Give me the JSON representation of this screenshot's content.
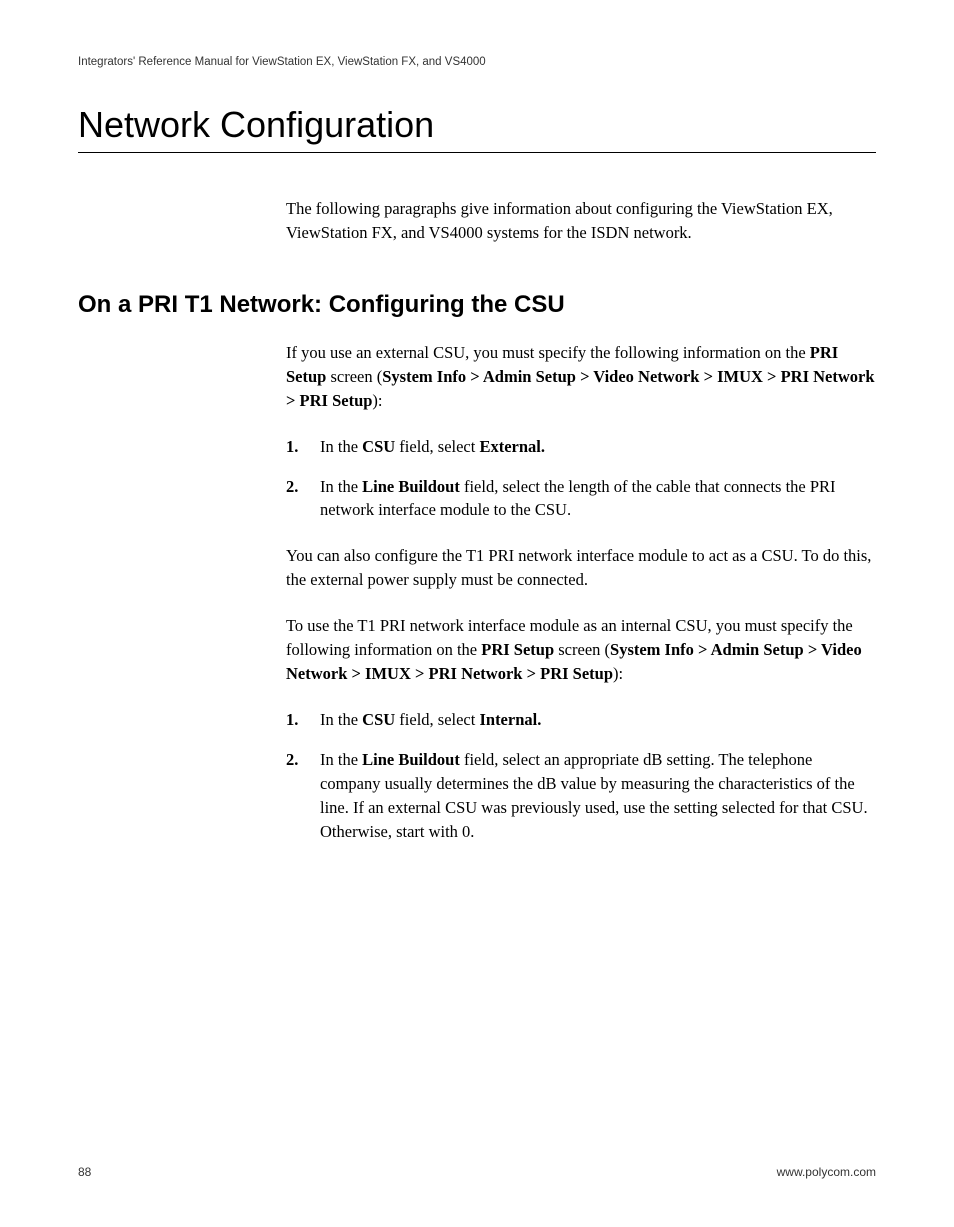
{
  "running_header": "Integrators' Reference Manual for ViewStation EX, ViewStation FX, and VS4000",
  "chapter_title": "Network Configuration",
  "intro": "The following paragraphs give information about configuring the ViewStation EX, ViewStation FX, and VS4000 systems for the ISDN network.",
  "section_title": "On a PRI T1 Network: Configuring the CSU",
  "p1_a": "If you use an external CSU, you must specify the following information on the ",
  "p1_b": "PRI Setup",
  "p1_c": " screen (",
  "p1_d": "System Info > Admin Setup > Video Network > IMUX > PRI Network > PRI Setup",
  "p1_e": "):",
  "steps1": {
    "s1": {
      "num": "1.",
      "a": "In the ",
      "b": "CSU",
      "c": " field, select ",
      "d": "External."
    },
    "s2": {
      "num": "2.",
      "a": "In the ",
      "b": "Line Buildout",
      "c": " field, select the length of the cable that connects the PRI network interface module to the CSU."
    }
  },
  "p2": "You can also configure the T1 PRI network interface module to act as a CSU. To do this, the external power supply must be connected.",
  "p3_a": "To use the T1 PRI network interface module as an internal CSU, you must specify the following information on the ",
  "p3_b": "PRI Setup",
  "p3_c": " screen (",
  "p3_d": "System Info > Admin Setup > Video Network > IMUX > PRI Network > PRI Setup",
  "p3_e": "):",
  "steps2": {
    "s1": {
      "num": "1.",
      "a": "In the ",
      "b": "CSU",
      "c": " field, select ",
      "d": "Internal."
    },
    "s2": {
      "num": "2.",
      "a": "In the ",
      "b": "Line Buildout",
      "c": " field, select an appropriate dB setting. The telephone company usually determines the dB value by measuring the characteristics of the line. If an external CSU was previously used, use the setting selected for that CSU. Otherwise, start with 0."
    }
  },
  "footer": {
    "page": "88",
    "url": "www.polycom.com"
  }
}
